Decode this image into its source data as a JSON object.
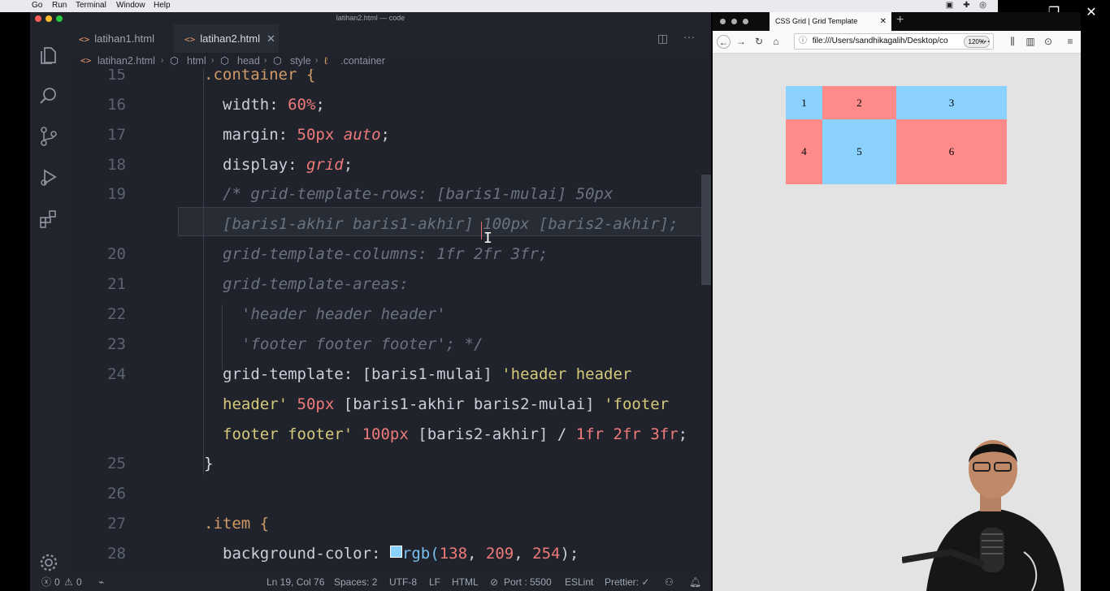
{
  "menubar": {
    "items": [
      "Go",
      "Run",
      "Terminal",
      "Window",
      "Help"
    ]
  },
  "vscode": {
    "window_title": "latihan2.html — code",
    "tabs": [
      {
        "label": "latihan1.html",
        "active": false
      },
      {
        "label": "latihan2.html",
        "active": true
      }
    ],
    "breadcrumb": [
      "latihan2.html",
      "html",
      "head",
      "style",
      ".container"
    ],
    "editor": {
      "line_numbers": [
        "15",
        "16",
        "17",
        "18",
        "19",
        "20",
        "21",
        "22",
        "23",
        "24",
        "25",
        "26",
        "27",
        "28"
      ],
      "code": {
        "l15": ".container {",
        "l16_prop": "width",
        "l16_val": "60%",
        "l17_prop": "margin",
        "l17_val1": "50px",
        "l17_val2": "auto",
        "l18_prop": "display",
        "l18_val": "grid",
        "l19a": "/* grid-template-rows: [baris1-mulai] 50px",
        "l19b": "[baris1-akhir baris1-akhir] 100px [baris2-akhir];",
        "l20": "grid-template-columns: 1fr 2fr 3fr;",
        "l21": "grid-template-areas:",
        "l22": "'header header header'",
        "l23": "'footer footer footer'; */",
        "l24a_prop": "grid-template",
        "l24a_name": "[baris1-mulai]",
        "l24a_str": "'header header",
        "l24b_str": "header'",
        "l24b_num": "50px",
        "l24b_name": "[baris1-akhir baris2-mulai]",
        "l24b_str2": "'footer",
        "l24c_str": "footer footer'",
        "l24c_num": "100px",
        "l24c_name": "[baris2-akhir] /",
        "l24c_fr1": "1fr",
        "l24c_fr2": "2fr",
        "l24c_fr3": "3fr",
        "l25": "}",
        "l27": ".item {",
        "l28_prop": "background-color",
        "l28_fn": "rgb(",
        "l28_r": "138",
        "l28_g": "209",
        "l28_b": "254",
        "l28_end": ");"
      }
    },
    "statusbar": {
      "errors": "0",
      "warnings": "0",
      "position": "Ln 19, Col 76",
      "spaces": "Spaces: 2",
      "encoding": "UTF-8",
      "eol": "LF",
      "language": "HTML",
      "port": "Port : 5500",
      "eslint": "ESLint",
      "prettier": "Prettier: ✓"
    }
  },
  "firefox": {
    "tab_title": "CSS Grid | Grid Template",
    "url": "file:///Users/sandhikagalih/Desktop/co",
    "zoom": "120%",
    "grid_cells": [
      {
        "label": "1",
        "color": "#8ad1fe"
      },
      {
        "label": "2",
        "color": "#ff8a8a"
      },
      {
        "label": "3",
        "color": "#8ad1fe"
      },
      {
        "label": "4",
        "color": "#ff8a8a"
      },
      {
        "label": "5",
        "color": "#8ad1fe"
      },
      {
        "label": "6",
        "color": "#ff8a8a"
      }
    ]
  },
  "colors": {
    "editor_bg": "#20232b",
    "swatch": "#8ad1fe"
  }
}
